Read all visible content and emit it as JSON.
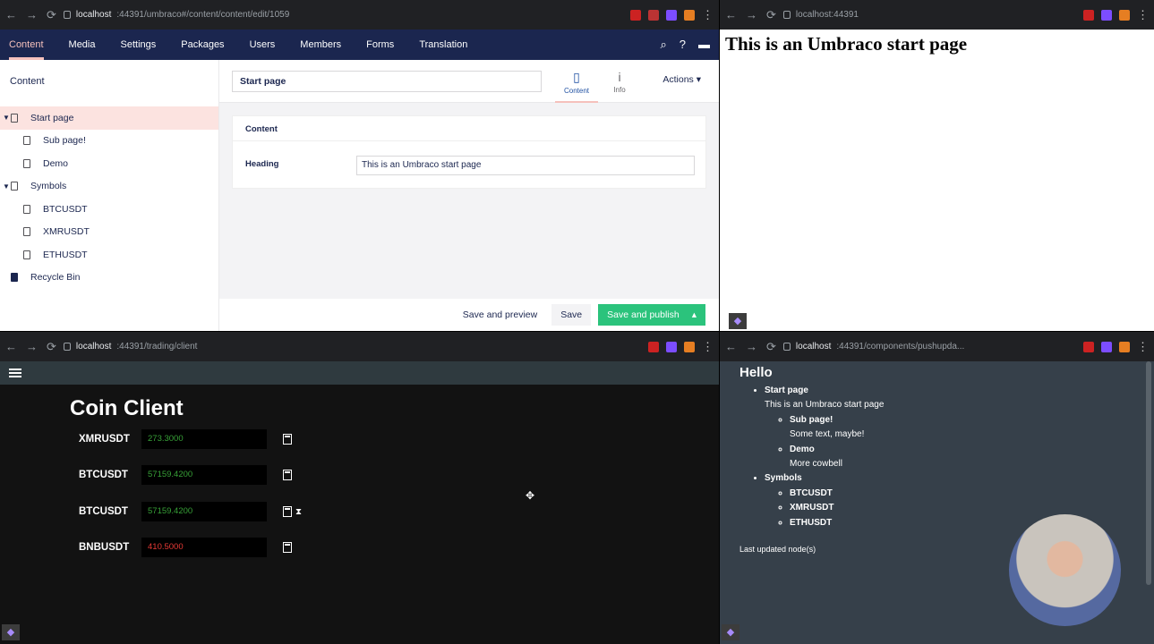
{
  "win1": {
    "url_host": "localhost",
    "url_rest": ":44391/umbraco#/content/content/edit/1059",
    "sections": [
      "Content",
      "Media",
      "Settings",
      "Packages",
      "Users",
      "Members",
      "Forms",
      "Translation"
    ],
    "tree_header": "Content",
    "tree": [
      "Start page",
      "Sub page!",
      "Demo",
      "Symbols",
      "BTCUSDT",
      "XMRUSDT",
      "ETHUSDT",
      "Recycle Bin"
    ],
    "node_name": "Start page",
    "tab_content": "Content",
    "tab_info": "Info",
    "actions": "Actions",
    "group_title": "Content",
    "field_label": "Heading",
    "field_value": "This is an Umbraco start page",
    "btn_preview": "Save and preview",
    "btn_save": "Save",
    "btn_publish": "Save and publish"
  },
  "win2": {
    "url": "localhost:44391",
    "heading": "This is an Umbraco start page"
  },
  "win3": {
    "url_host": "localhost",
    "url_rest": ":44391/trading/client",
    "title": "Coin Client",
    "rows": [
      {
        "symbol": "XMRUSDT",
        "price": "273.3000",
        "color": "#37a037"
      },
      {
        "symbol": "BTCUSDT",
        "price": "57159.4200",
        "color": "#37a037"
      },
      {
        "symbol": "BTCUSDT",
        "price": "57159.4200",
        "color": "#37a037"
      },
      {
        "symbol": "BNBUSDT",
        "price": "410.5000",
        "color": "#e53935"
      }
    ]
  },
  "win4": {
    "url_host": "localhost",
    "url_rest": ":44391/components/pushupda...",
    "heading": "Hello",
    "start_page": "Start page",
    "start_text": "This is an Umbraco start page",
    "sub_page": "Sub page!",
    "sub_text": "Some text, maybe!",
    "demo": "Demo",
    "demo_text": "More cowbell",
    "symbols": "Symbols",
    "sym1": "BTCUSDT",
    "sym2": "XMRUSDT",
    "sym3": "ETHUSDT",
    "last_updated": "Last updated node(s)"
  }
}
